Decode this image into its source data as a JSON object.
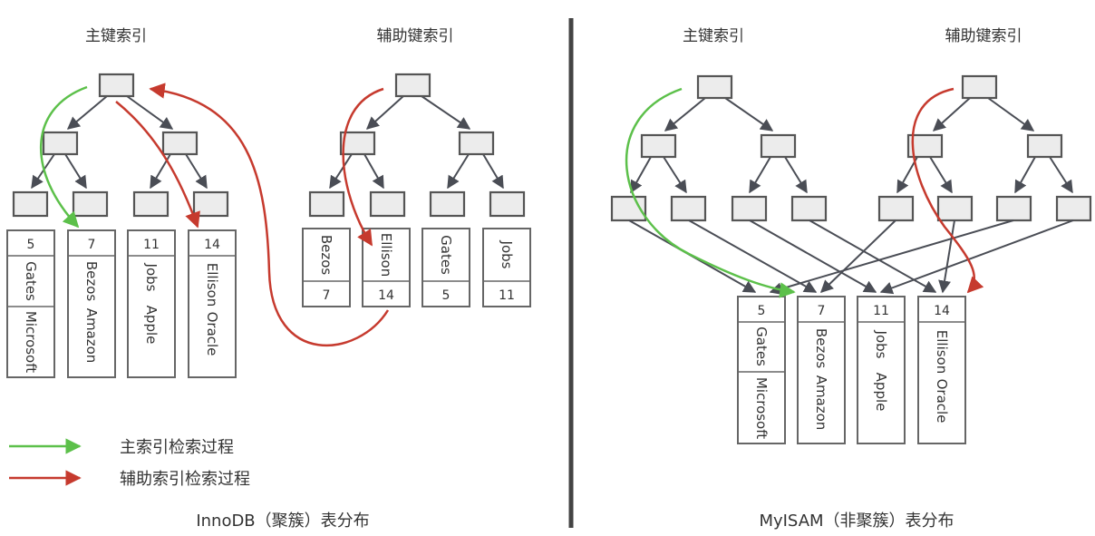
{
  "innodb": {
    "primary_label": "主键索引",
    "secondary_label": "辅助键索引",
    "caption": "InnoDB（聚簇）表分布",
    "primary_records": [
      {
        "id": "5",
        "name": "Gates",
        "company": "Microsoft"
      },
      {
        "id": "7",
        "name": "Bezos",
        "company": "Amazon"
      },
      {
        "id": "11",
        "name": "Jobs",
        "company": "Apple"
      },
      {
        "id": "14",
        "name": "Ellison",
        "company": "Oracle"
      }
    ],
    "secondary_records": [
      {
        "name": "Bezos",
        "id": "7"
      },
      {
        "name": "Ellison",
        "id": "14"
      },
      {
        "name": "Gates",
        "id": "5"
      },
      {
        "name": "Jobs",
        "id": "11"
      }
    ]
  },
  "myisam": {
    "primary_label": "主键索引",
    "secondary_label": "辅助键索引",
    "caption": "MyISAM（非聚簇）表分布",
    "records": [
      {
        "id": "5",
        "name": "Gates",
        "company": "Microsoft"
      },
      {
        "id": "7",
        "name": "Bezos",
        "company": "Amazon"
      },
      {
        "id": "11",
        "name": "Jobs",
        "company": "Apple"
      },
      {
        "id": "14",
        "name": "Ellison",
        "company": "Oracle"
      }
    ]
  },
  "legend": {
    "primary": {
      "label": "主索引检索过程",
      "color": "#5cc04a"
    },
    "secondary": {
      "label": "辅助索引检索过程",
      "color": "#c63a2e"
    }
  },
  "colors": {
    "node_fill": "#ececec",
    "node_stroke": "#555555",
    "edge": "#4a4d55",
    "divider": "#444444"
  }
}
